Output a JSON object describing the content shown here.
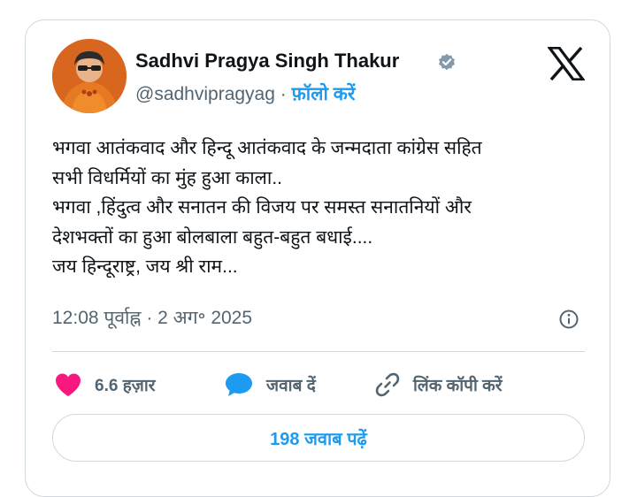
{
  "author": {
    "display_name": "Sadhvi Pragya Singh Thakur",
    "handle": "@sadhvipragyag",
    "separator": " · ",
    "follow_label": "फ़ॉलो करें"
  },
  "tweet": {
    "lines": [
      "भगवा आतंकवाद और हिन्दू आतंकवाद के जन्मदाता कांग्रेस सहित",
      "सभी  विधर्मियों का मुंह हुआ काला..",
      "भगवा ,हिंदुत्व और सनातन की विजय पर समस्त सनातनियों और",
      "देशभक्तों का हुआ बोलबाला बहुत-बहुत  बधाई....",
      "जय हिन्दूराष्ट्र, जय श्री राम..."
    ],
    "timestamp": "12:08 पूर्वाह्न · 2 अग॰ 2025"
  },
  "actions": {
    "like_count": "6.6 हज़ार",
    "reply_label": "जवाब दें",
    "copy_link_label": "लिंक कॉपी करें"
  },
  "read_replies_label": "198 जवाब पढ़ें",
  "colors": {
    "accent": "#1d9bf0",
    "like": "#f91880",
    "muted": "#536471",
    "text": "#0f1419",
    "border": "#cfd9de"
  },
  "icons": {
    "verified": "verified-badge-icon",
    "brand": "x-logo-icon",
    "info": "info-icon",
    "like": "heart-icon",
    "reply": "speech-bubble-icon",
    "copy": "link-icon"
  }
}
